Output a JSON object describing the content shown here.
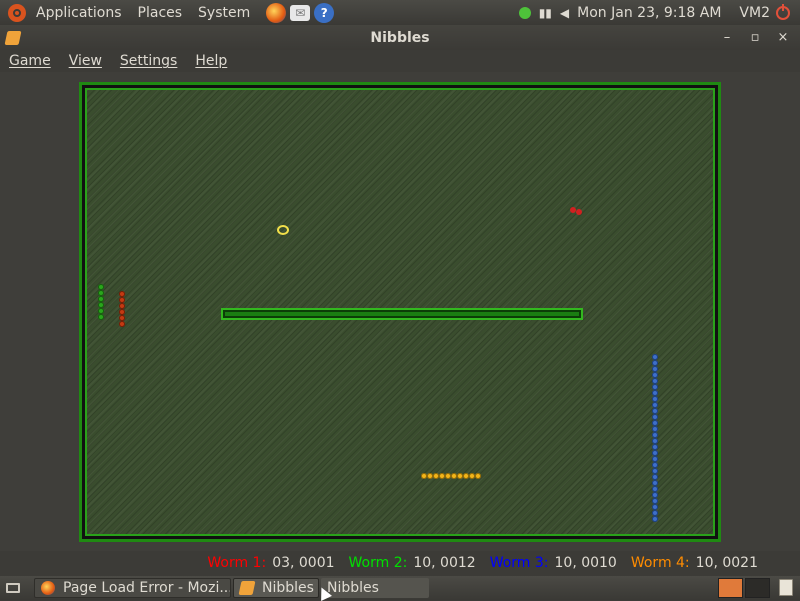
{
  "top_panel": {
    "menus": [
      "Applications",
      "Places",
      "System"
    ],
    "clock": "Mon Jan 23,  9:18 AM",
    "host": "VM2"
  },
  "window": {
    "title": "Nibbles",
    "controls": {
      "minimize": "–",
      "maximize": "▫",
      "close": "×"
    }
  },
  "menubar": {
    "items": [
      "Game",
      "View",
      "Settings",
      "Help"
    ]
  },
  "status": {
    "worms": [
      {
        "label": "Worm 1:",
        "score": "03, 0001",
        "color": "#ff0000"
      },
      {
        "label": "Worm 2:",
        "score": "10, 0012",
        "color": "#00e000"
      },
      {
        "label": "Worm 3:",
        "score": "10, 0010",
        "color": "#0000ff"
      },
      {
        "label": "Worm 4:",
        "score": "10, 0021",
        "color": "#ff8c00"
      }
    ]
  },
  "taskbar": {
    "tasks": [
      {
        "label": "Page Load Error - Mozi...",
        "icon": "firefox-icon"
      },
      {
        "label": "Nibbles",
        "icon": "nibbles-icon"
      },
      {
        "label": "Nibbles",
        "icon": ""
      }
    ]
  },
  "colors": {
    "panel": "#3c3b37",
    "arena_wall": "#1f8a12",
    "worm_green": "#2aa61c",
    "worm_red": "#c43a12",
    "worm_blue": "#3e6fc8",
    "worm_yellow": "#f2b51a"
  }
}
